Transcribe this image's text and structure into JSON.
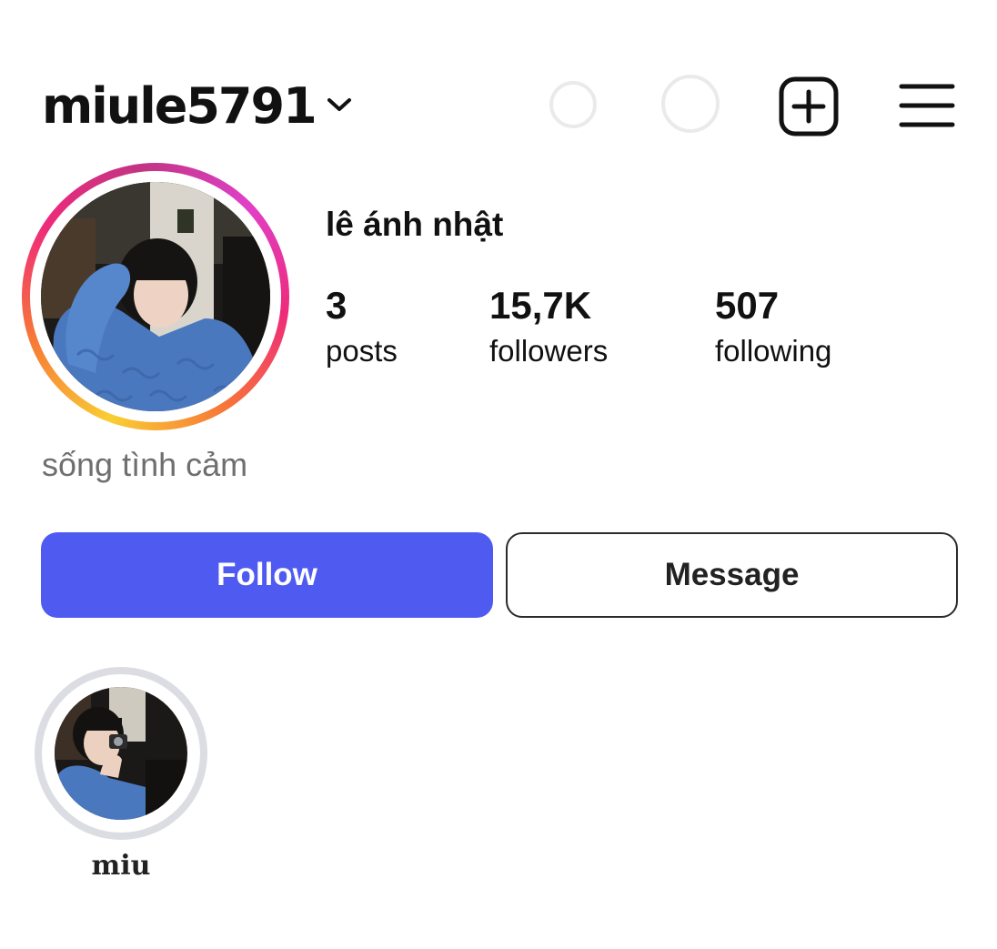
{
  "header": {
    "username": "miule5791",
    "icons": [
      "chevron-down-icon",
      "add-post-icon",
      "menu-icon"
    ]
  },
  "profile": {
    "display_name": "lê ánh nhật",
    "bio": "sống tình cảm",
    "stats": {
      "posts": {
        "value": "3",
        "label": "posts"
      },
      "followers": {
        "value": "15,7K",
        "label": "followers"
      },
      "following": {
        "value": "507",
        "label": "following"
      }
    },
    "story_ring_colors": [
      "#f9ce34",
      "#f77737",
      "#ee2a7b",
      "#c13584"
    ]
  },
  "actions": {
    "follow_label": "Follow",
    "message_label": "Message",
    "follow_color": "#4f5bf0"
  },
  "highlights": [
    {
      "label": "miu"
    }
  ]
}
